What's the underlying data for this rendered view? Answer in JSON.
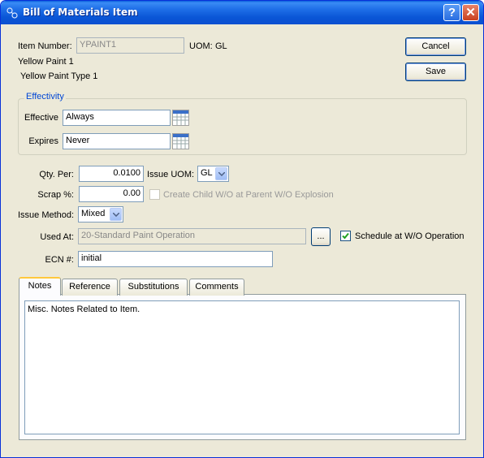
{
  "window": {
    "title": "Bill of Materials Item"
  },
  "item": {
    "number_label": "Item Number:",
    "number_value": "YPAINT1",
    "uom_label": "UOM:",
    "uom_value": "GL",
    "desc1": "Yellow Paint 1",
    "desc2": "Yellow Paint Type 1"
  },
  "buttons": {
    "cancel": "Cancel",
    "save": "Save",
    "ellipsis": "..."
  },
  "effectivity": {
    "title": "Effectivity",
    "effective_label": "Effective",
    "effective_value": "Always",
    "expires_label": "Expires",
    "expires_value": "Never"
  },
  "qty": {
    "qty_per_label": "Qty. Per:",
    "qty_per_value": "0.0100",
    "issue_uom_label": "Issue UOM:",
    "issue_uom_value": "GL",
    "scrap_label": "Scrap %:",
    "scrap_value": "0.00",
    "create_child_label": "Create Child W/O at Parent W/O Explosion",
    "create_child_checked": false,
    "issue_method_label": "Issue Method:",
    "issue_method_value": "Mixed",
    "used_at_label": "Used At:",
    "used_at_value": "20-Standard Paint Operation",
    "schedule_label": "Schedule at W/O Operation",
    "schedule_checked": true,
    "ecn_label": "ECN #:",
    "ecn_value": "initial"
  },
  "tabs": [
    {
      "label": "Notes",
      "active": true
    },
    {
      "label": "Reference",
      "active": false
    },
    {
      "label": "Substitutions",
      "active": false
    },
    {
      "label": "Comments",
      "active": false
    }
  ],
  "notes": {
    "text": "Misc. Notes Related to Item."
  },
  "colors": {
    "titlebar": "#0a56d6",
    "window_bg": "#ece9d8",
    "group_title": "#0046d5"
  }
}
